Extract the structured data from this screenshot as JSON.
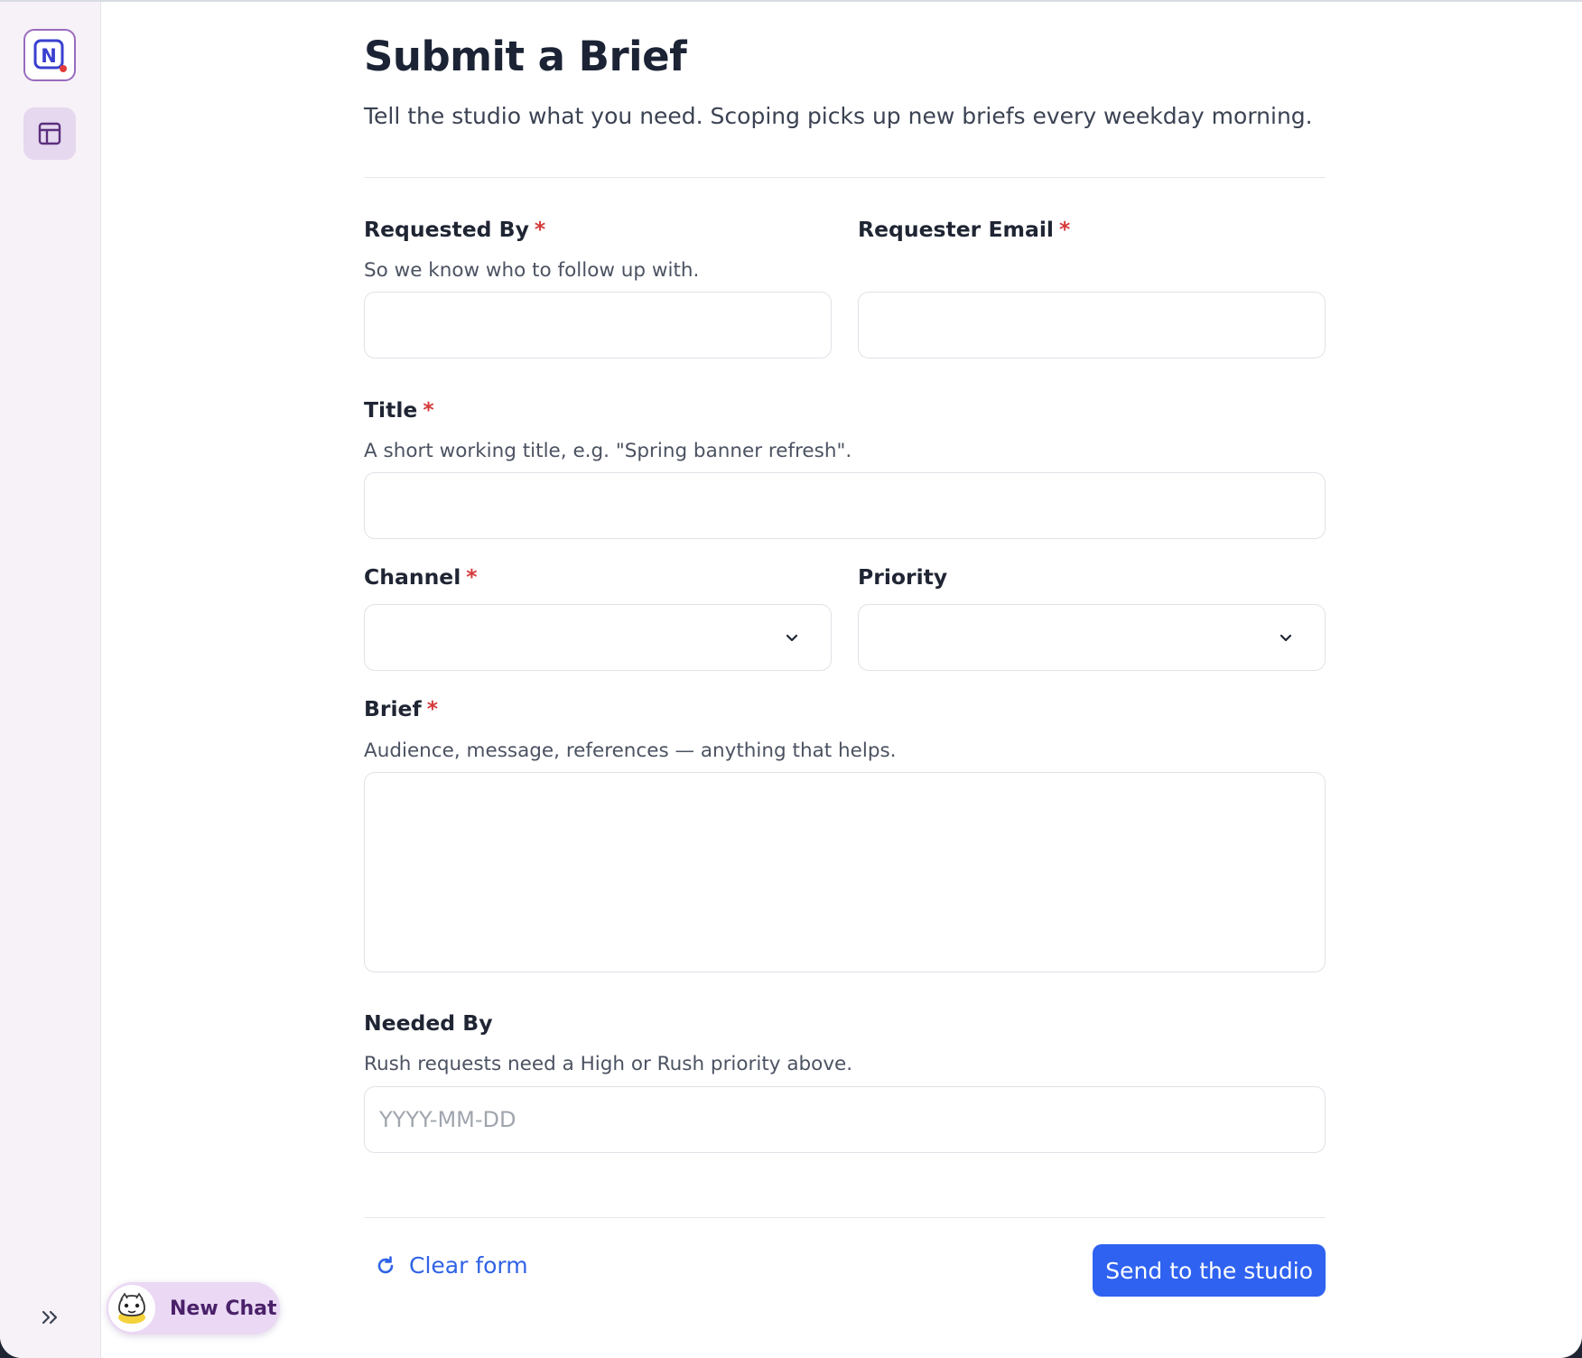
{
  "page": {
    "title": "Submit a Brief",
    "subtitle": "Tell the studio what you need. Scoping picks up new briefs every weekday morning."
  },
  "sidebar": {
    "logo_letter": "N",
    "items": [
      {
        "icon": "layout-icon",
        "active": true
      }
    ],
    "expand_icon": "double-chevron-right-icon"
  },
  "form": {
    "required_marker": "*",
    "requested_by": {
      "label": "Requested By",
      "required": true,
      "hint": "So we know who to follow up with.",
      "value": ""
    },
    "requester_email": {
      "label": "Requester Email",
      "required": true,
      "value": ""
    },
    "title": {
      "label": "Title",
      "required": true,
      "hint": "A short working title, e.g. \"Spring banner refresh\".",
      "value": ""
    },
    "channel": {
      "label": "Channel",
      "required": true,
      "value": ""
    },
    "priority": {
      "label": "Priority",
      "required": false,
      "value": ""
    },
    "brief": {
      "label": "Brief",
      "required": true,
      "hint": "Audience, message, references — anything that helps.",
      "value": ""
    },
    "needed_by": {
      "label": "Needed By",
      "required": false,
      "hint": "Rush requests need a High or Rush priority above.",
      "placeholder": "YYYY-MM-DD",
      "value": ""
    }
  },
  "actions": {
    "clear_label": "Clear form",
    "submit_label": "Send to the studio"
  },
  "chat": {
    "new_chat_label": "New Chat"
  },
  "colors": {
    "accent": "#2f62f0",
    "required": "#d63a3a",
    "brand": "#9a6bbf"
  }
}
